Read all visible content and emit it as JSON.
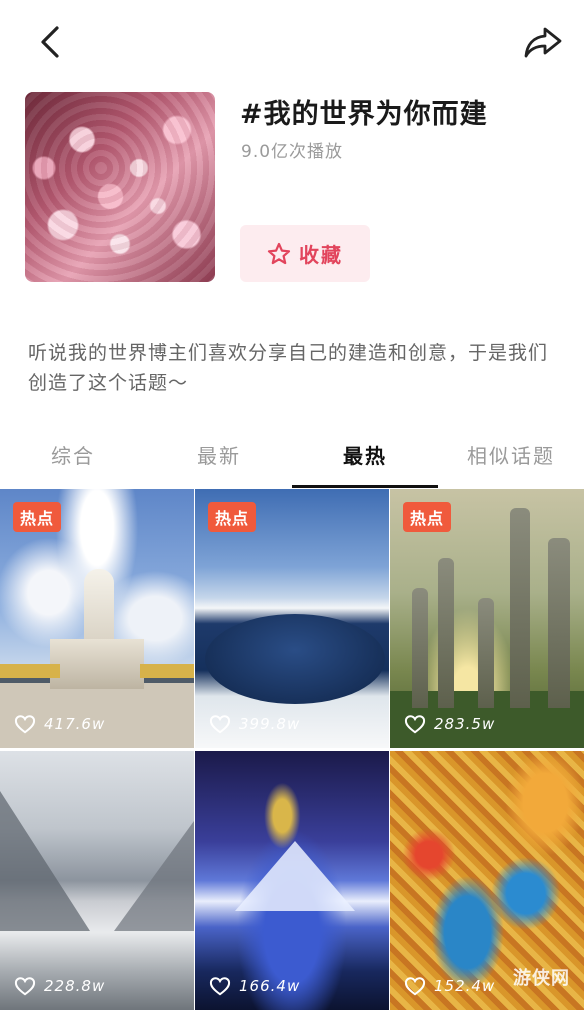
{
  "topbar": {
    "back_icon": "chevron-left-icon",
    "share_icon": "share-arrow-icon"
  },
  "header": {
    "title": "#我的世界为你而建",
    "play_count": "9.0亿次播放",
    "favorite_label": "收藏",
    "favorite_icon": "star-outline-icon",
    "accent_color": "#e2445c"
  },
  "description": "听说我的世界博主们喜欢分享自己的建造和创意，于是我们创造了这个话题～",
  "tabs": [
    {
      "label": "综合",
      "active": false
    },
    {
      "label": "最新",
      "active": false
    },
    {
      "label": "最热",
      "active": true
    },
    {
      "label": "相似话题",
      "active": false
    }
  ],
  "videos": [
    {
      "badge": "热点",
      "likes": "417.6w"
    },
    {
      "badge": "热点",
      "likes": "399.8w"
    },
    {
      "badge": "热点",
      "likes": "283.5w"
    },
    {
      "badge": "",
      "likes": "228.8w"
    },
    {
      "badge": "",
      "likes": "166.4w"
    },
    {
      "badge": "",
      "likes": "152.4w"
    }
  ],
  "watermark": "游侠网",
  "colors": {
    "hot_badge": "#f05a3c",
    "favorite_bg": "#fdecef"
  }
}
